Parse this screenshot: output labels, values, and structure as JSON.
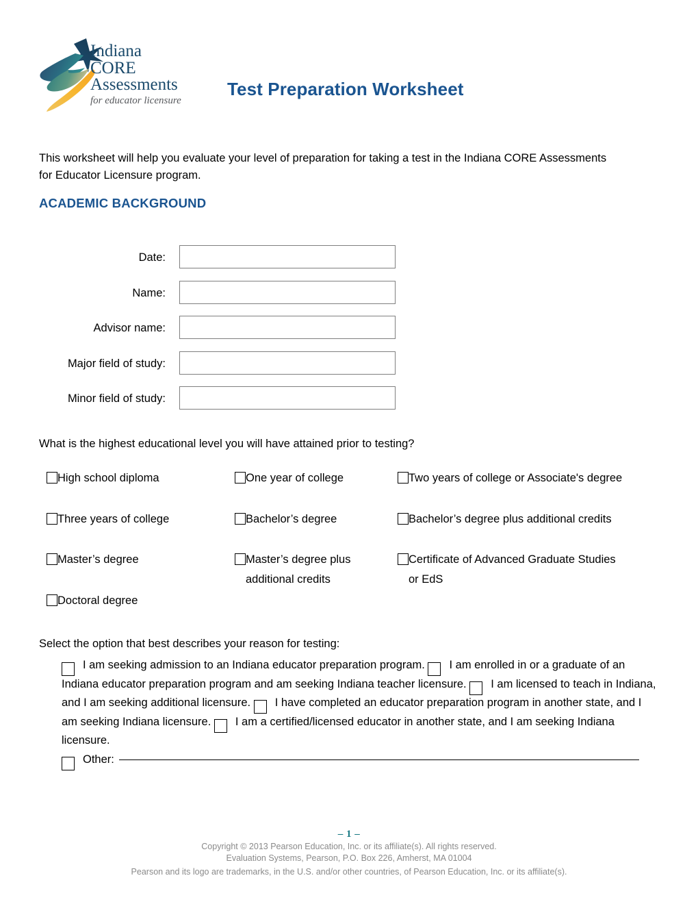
{
  "header": {
    "logo": {
      "icon_name": "indiana-core-shooting-star-logo",
      "line1": "Indiana",
      "line2": "CORE",
      "line3": "Assessments",
      "tagline": "for educator licensure",
      "brand_navy": "#1b4a6b",
      "brand_teal": "#2f8f8f",
      "brand_gold": "#f5b335"
    },
    "title": "Test Preparation Worksheet",
    "title_color": "#1a5490"
  },
  "intro": "This worksheet will help you evaluate your level of preparation for taking a test in the Indiana CORE Assessments for Educator Licensure program.",
  "section_heading": "ACADEMIC BACKGROUND",
  "fields": [
    {
      "label": "Date:",
      "value": ""
    },
    {
      "label": "Name:",
      "value": ""
    },
    {
      "label": "Advisor name:",
      "value": ""
    },
    {
      "label": "Major field of study:",
      "value": ""
    },
    {
      "label": "Minor field of study:",
      "value": ""
    }
  ],
  "education": {
    "question": "What is the highest educational level you will have attained prior to testing?",
    "rows": [
      [
        {
          "label": "High school diploma",
          "checked": false
        },
        {
          "label": "One year of college",
          "checked": false
        },
        {
          "label": "Two years of college or Associate's degree",
          "checked": false
        }
      ],
      [
        {
          "label": "Three years of college",
          "checked": false
        },
        {
          "label": "Bachelor’s degree",
          "checked": false
        },
        {
          "label": "Bachelor’s degree plus additional credits",
          "checked": false
        }
      ],
      [
        {
          "label": "Master’s degree",
          "checked": false
        },
        {
          "label": "Master’s degree plus additional credits",
          "checked": false
        },
        {
          "label": "Certificate of Advanced Graduate Studies or EdS",
          "checked": false
        }
      ],
      [
        {
          "label": "Doctoral degree",
          "checked": false
        },
        {
          "label": "",
          "checked": false
        },
        {
          "label": "",
          "checked": false
        }
      ]
    ]
  },
  "reason": {
    "question": "Select the option that best describes your reason for testing:",
    "options": [
      {
        "label": "I am seeking admission to an Indiana educator preparation program.",
        "checked": false
      },
      {
        "label": "I am enrolled in or a graduate of an Indiana educator preparation program and am seeking Indiana teacher licensure.",
        "checked": false
      },
      {
        "label": "I am licensed to teach in Indiana, and I am seeking additional licensure.",
        "checked": false
      },
      {
        "label": "I have completed an educator preparation program in another state, and I am seeking Indiana licensure.",
        "checked": false
      },
      {
        "label": "I am a certified/licensed educator in another state, and I am seeking Indiana licensure.",
        "checked": false
      }
    ],
    "other_label": "Other:",
    "other_value": ""
  },
  "footer": {
    "page_number": "– 1 –",
    "page_number_color": "#1a7a85",
    "copyright": "Copyright © 2013 Pearson Education, Inc. or its affiliate(s).  All rights reserved.",
    "address": "Evaluation Systems, Pearson, P.O. Box 226, Amherst, MA  01004",
    "trademark": "Pearson and its logo are trademarks, in the U.S. and/or other countries, of Pearson Education, Inc. or its affiliate(s)."
  }
}
